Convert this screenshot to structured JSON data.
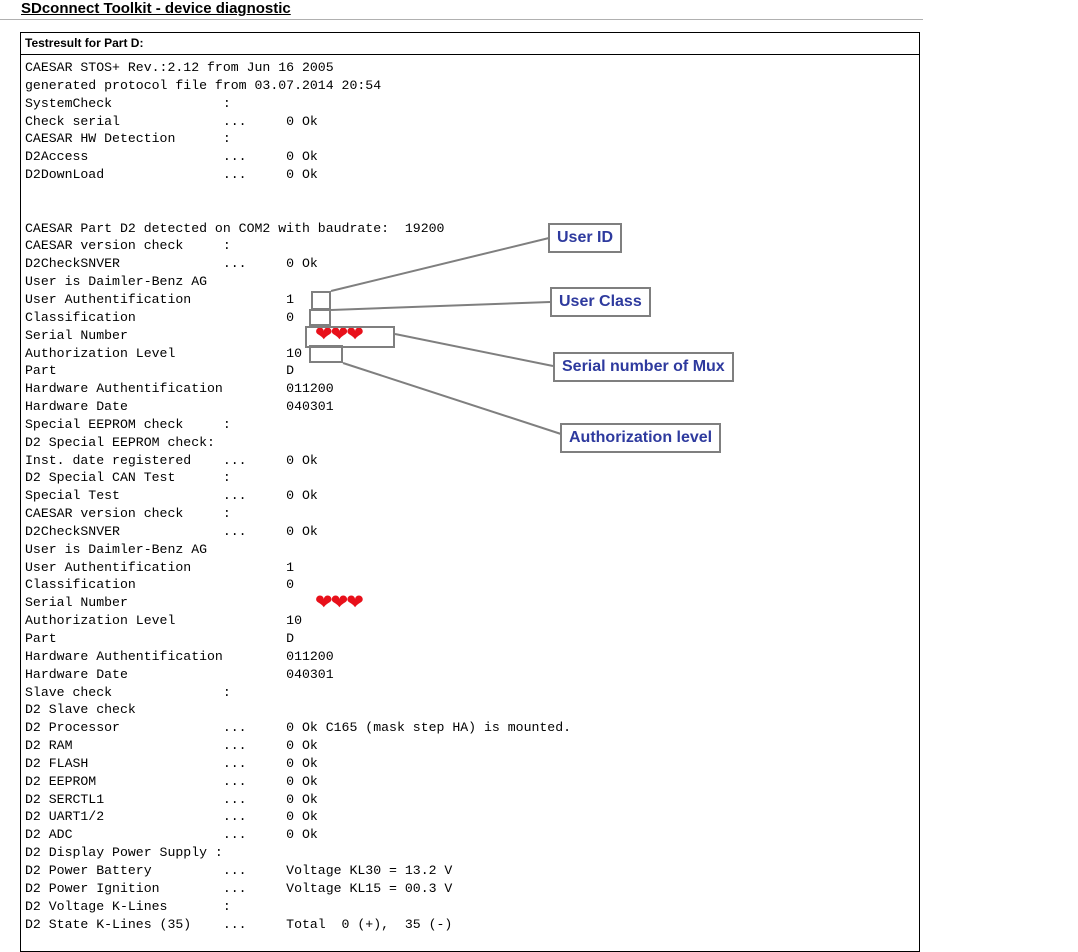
{
  "title": "SDconnect Toolkit - device diagnostic",
  "box_header": "Testresult for Part D:",
  "log_lines": [
    "CAESAR STOS+ Rev.:2.12 from Jun 16 2005",
    "generated protocol file from 03.07.2014 20:54",
    "SystemCheck              :",
    "Check serial             ...     0 Ok",
    "CAESAR HW Detection      :",
    "D2Access                 ...     0 Ok",
    "D2DownLoad               ...     0 Ok",
    "",
    "",
    "CAESAR Part D2 detected on COM2 with baudrate:  19200",
    "CAESAR version check     :",
    "D2CheckSNVER             ...     0 Ok",
    "User is Daimler-Benz AG",
    "User Authentification            1",
    "Classification                   0",
    "Serial Number",
    "Authorization Level              10",
    "Part                             D",
    "Hardware Authentification        011200",
    "Hardware Date                    040301",
    "Special EEPROM check     :",
    "D2 Special EEPROM check:",
    "Inst. date registered    ...     0 Ok",
    "D2 Special CAN Test      :",
    "Special Test             ...     0 Ok",
    "CAESAR version check     :",
    "D2CheckSNVER             ...     0 Ok",
    "User is Daimler-Benz AG",
    "User Authentification            1",
    "Classification                   0",
    "Serial Number",
    "Authorization Level              10",
    "Part                             D",
    "Hardware Authentification        011200",
    "Hardware Date                    040301",
    "Slave check              :",
    "D2 Slave check",
    "D2 Processor             ...     0 Ok C165 (mask step HA) is mounted.",
    "D2 RAM                   ...     0 Ok",
    "D2 FLASH                 ...     0 Ok",
    "D2 EEPROM                ...     0 Ok",
    "D2 SERCTL1               ...     0 Ok",
    "D2 UART1/2               ...     0 Ok",
    "D2 ADC                   ...     0 Ok",
    "D2 Display Power Supply :",
    "D2 Power Battery         ...     Voltage KL30 = 13.2 V",
    "D2 Power Ignition        ...     Voltage KL15 = 00.3 V",
    "D2 Voltage K-Lines       :",
    "D2 State K-Lines (35)    ...     Total  0 (+),  35 (-)"
  ],
  "redaction": {
    "glyphs": "❤❤❤",
    "color": "#e8101a"
  },
  "callouts": {
    "user_id": "User ID",
    "user_class": "User Class",
    "serial_mux": "Serial number of Mux",
    "auth_level": "Authorization level"
  },
  "colors": {
    "callout_text": "#2e3a9e",
    "callout_border": "#7f7f7f"
  }
}
